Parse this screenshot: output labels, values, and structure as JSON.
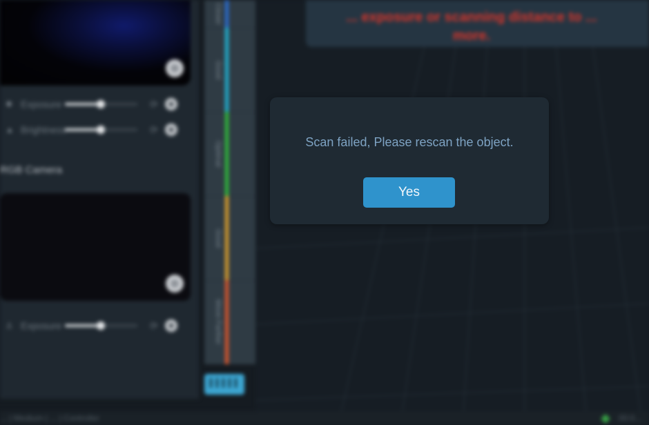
{
  "left_panel": {
    "depth_camera": {
      "exposure_label": "Exposure",
      "brightness_label": "Brightness",
      "exposure_level": 0.5,
      "brightness_level": 0.5
    },
    "rgb_camera": {
      "title": "RGB Camera",
      "exposure_label": "Exposure",
      "exposure_level": 0.5
    },
    "icons": {
      "exposure": "sun-icon",
      "brightness": "warning-triangle-icon",
      "reset": "refresh-icon",
      "settings": "gear-icon",
      "capture": "camera-capture-icon"
    }
  },
  "distance_indicator": {
    "segments": [
      {
        "label": "Closer",
        "color": "#2a6fd6"
      },
      {
        "label": "Good",
        "color": "#1fb7d8"
      },
      {
        "label": "Optimal",
        "color": "#2fbf3a"
      },
      {
        "label": "Good",
        "color": "#e2a22a"
      },
      {
        "label": "Move Farther",
        "color": "#e0562a"
      }
    ],
    "ruler_icon": "ruler-icon"
  },
  "warning": {
    "line1": "... exposure or scanning distance to ...",
    "line2": "more."
  },
  "status_bar": {
    "text": "... | Medium | ... | Controller",
    "right": "00:0..."
  },
  "dialog": {
    "message": "Scan failed, Please rescan the object.",
    "confirm_label": "Yes"
  }
}
